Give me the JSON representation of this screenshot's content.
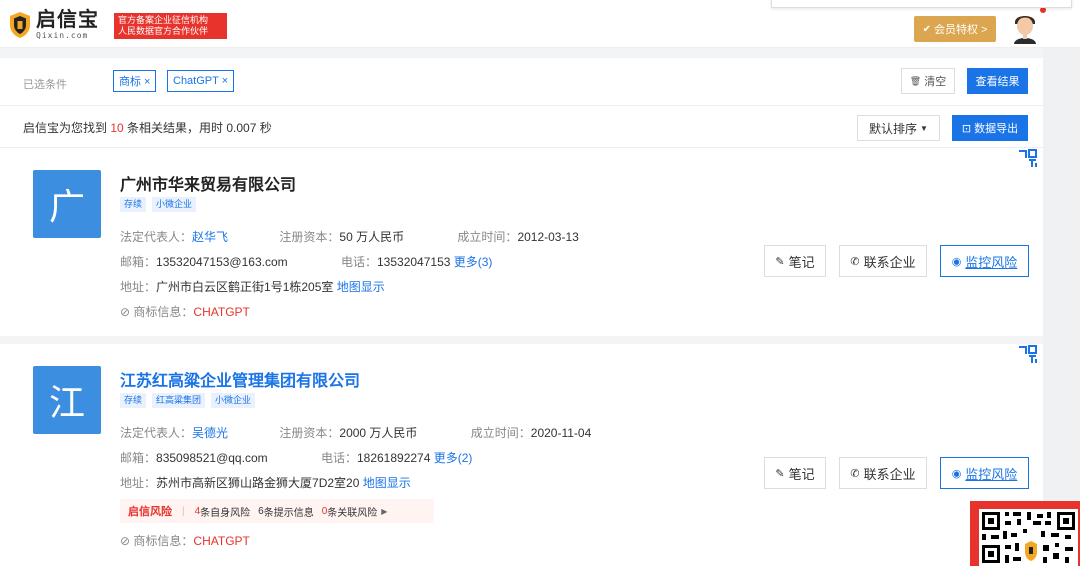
{
  "header": {
    "logo_cn": "启信宝",
    "logo_en": "Qixin.com",
    "cert_line1": "官方备案企业征信机构",
    "cert_line2": "人民数据官方合作伙伴",
    "vip_label": "会员特权 >"
  },
  "filter": {
    "label": "已选条件",
    "chips": [
      "商标 ×",
      "ChatGPT ×"
    ],
    "clear_label": "清空",
    "view_label": "查看结果"
  },
  "summary": {
    "prefix": "启信宝为您找到 ",
    "count": "10",
    "suffix": " 条相关结果，用时 0.007 秒",
    "sort_label": "默认排序",
    "export_label": "数据导出"
  },
  "results": [
    {
      "avatar_char": "广",
      "name": "广州市华来贸易有限公司",
      "tags": [
        "存续",
        "小微企业"
      ],
      "legal_rep_key": "法定代表人：",
      "legal_rep": "赵华飞",
      "capital_key": "注册资本：",
      "capital": "50 万人民币",
      "founded_key": "成立时间：",
      "founded": "2012-03-13",
      "email_key": "邮箱：",
      "email": "13532047153@163.com",
      "phone_key": "电话：",
      "phone": "13532047153",
      "more": "更多(3)",
      "address_key": "地址：",
      "address": "广州市白云区鹤正街1号1栋205室",
      "map_link": "地图显示",
      "trademark_key": "商标信息：",
      "trademark": "CHATGPT"
    },
    {
      "avatar_char": "江",
      "name": "江苏红高粱企业管理集团有限公司",
      "tags": [
        "存续",
        "红高粱集团",
        "小微企业"
      ],
      "legal_rep_key": "法定代表人：",
      "legal_rep": "吴德光",
      "capital_key": "注册资本：",
      "capital": "2000 万人民币",
      "founded_key": "成立时间：",
      "founded": "2020-11-04",
      "email_key": "邮箱：",
      "email": "835098521@qq.com",
      "phone_key": "电话：",
      "phone": "18261892274",
      "more": "更多(2)",
      "address_key": "地址：",
      "address": "苏州市高新区狮山路金狮大厦7D2室20",
      "map_link": "地图显示",
      "risk_brand": "启信风险",
      "risk_self_num": "4",
      "risk_self_label": " 条自身风险",
      "risk_hint_num": "6",
      "risk_hint_label": " 条提示信息",
      "risk_rel_num": "0",
      "risk_rel_label": " 条关联风险",
      "trademark_key": "商标信息：",
      "trademark": "CHATGPT"
    }
  ],
  "actions": {
    "note": "笔记",
    "contact": "联系企业",
    "monitor": "监控风险"
  },
  "colors": {
    "brand_blue": "#1a74e8",
    "accent_red": "#e7332b",
    "vip_gold": "#dca550",
    "avatar_blue": "#3b8ee0"
  }
}
